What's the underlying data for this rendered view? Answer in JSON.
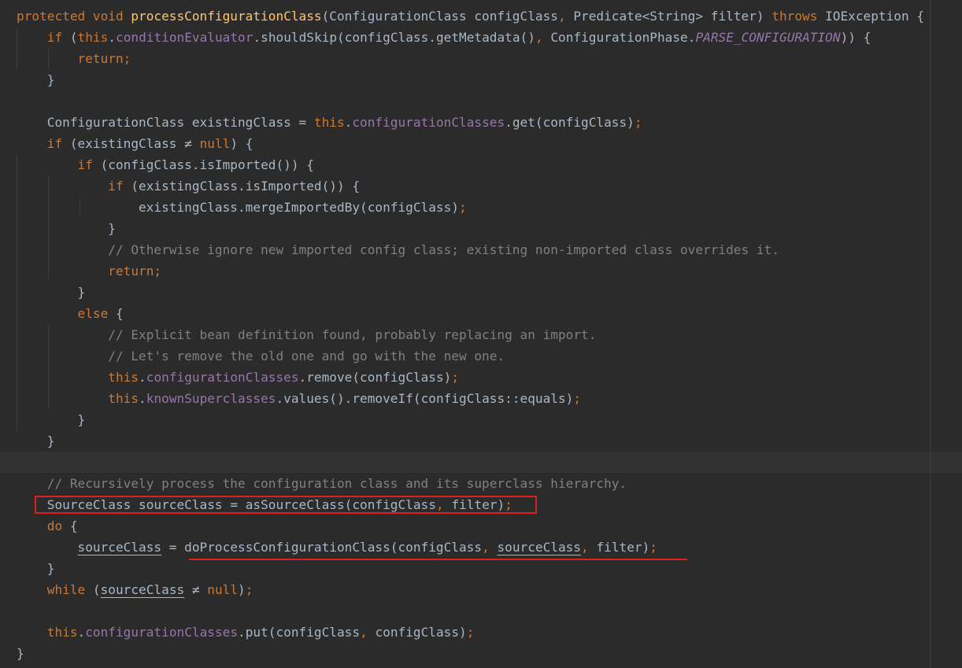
{
  "editor": {
    "lines": [
      [
        [
          "k",
          "protected void "
        ],
        [
          "m",
          "processConfigurationClass"
        ],
        [
          "t",
          "(ConfigurationClass configClass"
        ],
        [
          "k",
          ", "
        ],
        [
          "t",
          "Predicate<String> filter) "
        ],
        [
          "k",
          "throws "
        ],
        [
          "t",
          "IOException {"
        ]
      ],
      [
        [
          "t",
          "    "
        ],
        [
          "k",
          "if "
        ],
        [
          "t",
          "("
        ],
        [
          "k",
          "this"
        ],
        [
          "t",
          "."
        ],
        [
          "f",
          "conditionEvaluator"
        ],
        [
          "t",
          ".shouldSkip(configClass.getMetadata()"
        ],
        [
          "k",
          ", "
        ],
        [
          "t",
          "ConfigurationPhase."
        ],
        [
          "s",
          "PARSE_CONFIGURATION"
        ],
        [
          "t",
          ")) {"
        ]
      ],
      [
        [
          "t",
          "        "
        ],
        [
          "k",
          "return;"
        ]
      ],
      [
        [
          "t",
          "    }"
        ]
      ],
      [],
      [
        [
          "t",
          "    ConfigurationClass existingClass = "
        ],
        [
          "k",
          "this"
        ],
        [
          "t",
          "."
        ],
        [
          "f",
          "configurationClasses"
        ],
        [
          "t",
          ".get(configClass)"
        ],
        [
          "k",
          ";"
        ]
      ],
      [
        [
          "t",
          "    "
        ],
        [
          "k",
          "if "
        ],
        [
          "t",
          "(existingClass ≠ "
        ],
        [
          "k",
          "null"
        ],
        [
          "t",
          ") {"
        ]
      ],
      [
        [
          "t",
          "        "
        ],
        [
          "k",
          "if "
        ],
        [
          "t",
          "(configClass.isImported()) {"
        ]
      ],
      [
        [
          "t",
          "            "
        ],
        [
          "k",
          "if "
        ],
        [
          "t",
          "(existingClass.isImported()) {"
        ]
      ],
      [
        [
          "t",
          "                existingClass.mergeImportedBy(configClass)"
        ],
        [
          "k",
          ";"
        ]
      ],
      [
        [
          "t",
          "            }"
        ]
      ],
      [
        [
          "t",
          "            "
        ],
        [
          "c",
          "// Otherwise ignore new imported config class; existing non-imported class overrides it."
        ]
      ],
      [
        [
          "t",
          "            "
        ],
        [
          "k",
          "return;"
        ]
      ],
      [
        [
          "t",
          "        }"
        ]
      ],
      [
        [
          "t",
          "        "
        ],
        [
          "k",
          "else "
        ],
        [
          "t",
          "{"
        ]
      ],
      [
        [
          "t",
          "            "
        ],
        [
          "c",
          "// Explicit bean definition found, probably replacing an import."
        ]
      ],
      [
        [
          "t",
          "            "
        ],
        [
          "c",
          "// Let's remove the old one and go with the new one."
        ]
      ],
      [
        [
          "t",
          "            "
        ],
        [
          "k",
          "this"
        ],
        [
          "t",
          "."
        ],
        [
          "f",
          "configurationClasses"
        ],
        [
          "t",
          ".remove(configClass)"
        ],
        [
          "k",
          ";"
        ]
      ],
      [
        [
          "t",
          "            "
        ],
        [
          "k",
          "this"
        ],
        [
          "t",
          "."
        ],
        [
          "f",
          "knownSuperclasses"
        ],
        [
          "t",
          ".values().removeIf(configClass::equals)"
        ],
        [
          "k",
          ";"
        ]
      ],
      [
        [
          "t",
          "        }"
        ]
      ],
      [
        [
          "t",
          "    }"
        ]
      ],
      [],
      [
        [
          "t",
          "    "
        ],
        [
          "c",
          "// Recursively process the configuration class and its superclass hierarchy."
        ]
      ],
      [
        [
          "t",
          "    SourceClass "
        ],
        [
          "tu",
          "sourceClass"
        ],
        [
          "t",
          " = asSourceClass(configClass"
        ],
        [
          "k",
          ", "
        ],
        [
          "t",
          "filter)"
        ],
        [
          "k",
          ";"
        ]
      ],
      [
        [
          "t",
          "    "
        ],
        [
          "k",
          "do "
        ],
        [
          "t",
          "{"
        ]
      ],
      [
        [
          "t",
          "        "
        ],
        [
          "tu",
          "sourceClass"
        ],
        [
          "t",
          " = doProcessConfigurationClass(configClass"
        ],
        [
          "k",
          ", "
        ],
        [
          "tu",
          "sourceClass"
        ],
        [
          "k",
          ", "
        ],
        [
          "t",
          "filter)"
        ],
        [
          "k",
          ";"
        ]
      ],
      [
        [
          "t",
          "    }"
        ]
      ],
      [
        [
          "t",
          "    "
        ],
        [
          "k",
          "while "
        ],
        [
          "t",
          "("
        ],
        [
          "tu",
          "sourceClass"
        ],
        [
          "t",
          " ≠ "
        ],
        [
          "k",
          "null"
        ],
        [
          "t",
          ")"
        ],
        [
          "k",
          ";"
        ]
      ],
      [],
      [
        [
          "t",
          "    "
        ],
        [
          "k",
          "this"
        ],
        [
          "t",
          "."
        ],
        [
          "f",
          "configurationClasses"
        ],
        [
          "t",
          ".put(configClass"
        ],
        [
          "k",
          ", "
        ],
        [
          "t",
          "configClass)"
        ],
        [
          "k",
          ";"
        ]
      ],
      [
        [
          "t",
          "}"
        ]
      ]
    ]
  },
  "colors": {
    "background": "#2b2b2b",
    "keyword": "#cc7832",
    "method": "#ffc66d",
    "field": "#9876aa",
    "comment": "#808080",
    "text": "#a9b7c6",
    "highlight": "#e01e1e"
  }
}
